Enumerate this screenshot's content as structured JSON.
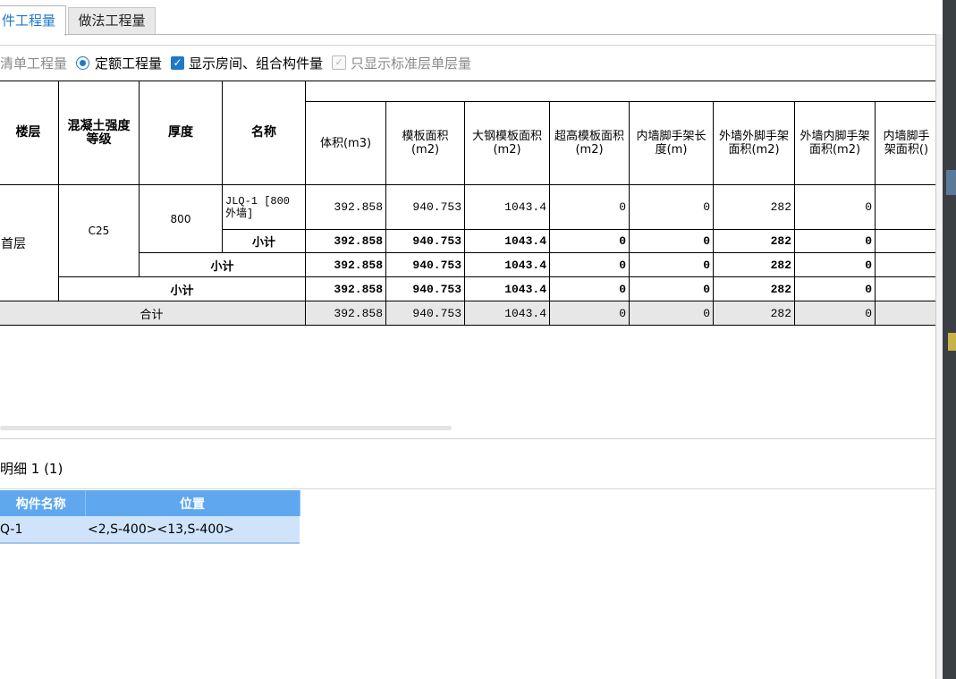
{
  "tabs": {
    "active": "件工程量",
    "other": "做法工程量"
  },
  "options": {
    "radio1": "清单工程量",
    "radio2": "定额工程量",
    "check1": "显示房间、组合构件量",
    "check2": "只显示标准层单层量"
  },
  "table": {
    "headers": {
      "floor": "楼层",
      "grade": "混凝土强度等级",
      "thickness": "厚度",
      "name": "名称",
      "vol": "体积(m3)",
      "form": "模板面积(m2)",
      "steel": "大钢模板面积(m2)",
      "superhigh": "超高模板面积(m2)",
      "innerlen": "内墙脚手架长度(m)",
      "outerout": "外墙外脚手架面积(m2)",
      "outerin": "外墙内脚手架面积(m2)",
      "innerarea": "内墙脚手架面积()"
    },
    "floor": "首层",
    "grade": "C25",
    "thickness": "800",
    "item_name": "JLQ-1 [800 外墙]",
    "subtotal_label": "小计",
    "total_label": "合计",
    "row_values": [
      "392.858",
      "940.753",
      "1043.4",
      "0",
      "0",
      "282",
      "0"
    ]
  },
  "detail": {
    "title": "明细 1 (1)",
    "col1": "构件名称",
    "col2": "位置",
    "row_name": "Q-1",
    "row_pos": "<2,S-400><13,S-400>"
  },
  "colors": {
    "accent": "#1e78c8",
    "detail_header": "#5fa8f0",
    "detail_row": "#cfe4fb",
    "total_row": "#e7e7e7"
  }
}
